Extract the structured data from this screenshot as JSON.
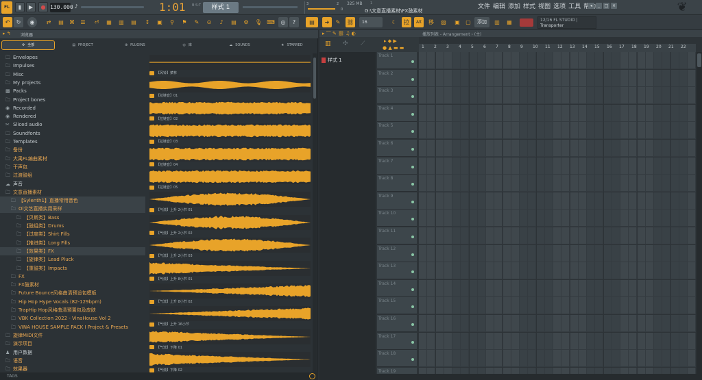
{
  "transport": {
    "tempo": "130.000",
    "time": "1:01",
    "time_sub": "00",
    "time_unit": "B:S:T",
    "pattern": "样式 1",
    "memory": "325 MB",
    "path": "G:\\文意直播素材\\FX鼓素材",
    "path_counter": "1",
    "cpu_value": "3",
    "poly_value": "2",
    "poly_sub": "0"
  },
  "menu": [
    "文件",
    "编辑",
    "添加",
    "样式",
    "视图",
    "选项",
    "工具",
    "帮助"
  ],
  "hint": {
    "line1": "12/16  FL STUDIO |",
    "line2": "Transporter"
  },
  "toolbar": {
    "snap": "16",
    "add_label": "添加",
    "mix_label": "Alt"
  },
  "browser": {
    "title": "浏览器",
    "tabs": [
      "全部",
      "PROJECT",
      "PLUGINS",
      "库",
      "SOUNDS",
      "STARRED"
    ],
    "tree": [
      {
        "label": "Envelopes",
        "orange": false,
        "indent": 0,
        "icon": "folder"
      },
      {
        "label": "Impulses",
        "orange": false,
        "indent": 0,
        "icon": "folder"
      },
      {
        "label": "Misc",
        "orange": false,
        "indent": 0,
        "icon": "folder"
      },
      {
        "label": "My projects",
        "orange": false,
        "indent": 0,
        "icon": "folder"
      },
      {
        "label": "Packs",
        "orange": false,
        "indent": 0,
        "icon": "packs"
      },
      {
        "label": "Project bones",
        "orange": false,
        "indent": 0,
        "icon": "folder"
      },
      {
        "label": "Recorded",
        "orange": false,
        "indent": 0,
        "icon": "record"
      },
      {
        "label": "Rendered",
        "orange": false,
        "indent": 0,
        "icon": "record"
      },
      {
        "label": "Sliced audio",
        "orange": false,
        "indent": 0,
        "icon": "slice"
      },
      {
        "label": "Soundfonts",
        "orange": false,
        "indent": 0,
        "icon": "folder"
      },
      {
        "label": "Templates",
        "orange": false,
        "indent": 0,
        "icon": "folder"
      },
      {
        "label": "备份",
        "orange": true,
        "indent": 0,
        "icon": "folder"
      },
      {
        "label": "大禹FL编曲素材",
        "orange": true,
        "indent": 0,
        "icon": "folder"
      },
      {
        "label": "干声包",
        "orange": true,
        "indent": 0,
        "icon": "folder"
      },
      {
        "label": "过渡鼓组",
        "orange": true,
        "indent": 0,
        "icon": "folder"
      },
      {
        "label": "声音",
        "orange": false,
        "indent": 0,
        "icon": "cloud"
      },
      {
        "label": "文意直播素材",
        "orange": true,
        "indent": 0,
        "icon": "folder"
      },
      {
        "label": "【Sylenth1】直播常用音色",
        "orange": true,
        "indent": 1,
        "icon": "folder"
      },
      {
        "label": "Ol文艺直播实用采样",
        "orange": true,
        "indent": 1,
        "icon": "folder"
      },
      {
        "label": "【贝斯类】Bass",
        "orange": true,
        "indent": 2,
        "icon": "folder"
      },
      {
        "label": "【鼓组类】Drums",
        "orange": true,
        "indent": 2,
        "icon": "folder"
      },
      {
        "label": "【过度类】Shirt Fills",
        "orange": true,
        "indent": 2,
        "icon": "folder"
      },
      {
        "label": "【推进类】Long Fills",
        "orange": true,
        "indent": 2,
        "icon": "folder"
      },
      {
        "label": "【效果类】FX",
        "orange": true,
        "indent": 2,
        "icon": "folder"
      },
      {
        "label": "【旋律类】Lead Pluck",
        "orange": true,
        "indent": 2,
        "icon": "folder"
      },
      {
        "label": "【重鼓类】Impacts",
        "orange": true,
        "indent": 2,
        "icon": "folder"
      },
      {
        "label": "FX",
        "orange": true,
        "indent": 1,
        "icon": "folder"
      },
      {
        "label": "FX鼓素材",
        "orange": true,
        "indent": 1,
        "icon": "folder"
      },
      {
        "label": "Future Bounce风格曲清预设包模板",
        "orange": true,
        "indent": 1,
        "icon": "folder"
      },
      {
        "label": "Hip Hop Hype Vocals (82-129bpm)",
        "orange": true,
        "indent": 1,
        "icon": "folder"
      },
      {
        "label": "TrapHip Hop风格曲清预置包及皮肤",
        "orange": true,
        "indent": 1,
        "icon": "folder"
      },
      {
        "label": "VBK Collection 2022 - VinaHouse Vol 2",
        "orange": true,
        "indent": 1,
        "icon": "folder"
      },
      {
        "label": "VINA HOUSE SAMPLE PACK I Project & Presets",
        "orange": true,
        "indent": 1,
        "icon": "folder"
      },
      {
        "label": "旋律MIDI文件",
        "orange": true,
        "indent": 0,
        "icon": "folder"
      },
      {
        "label": "演示项目",
        "orange": true,
        "indent": 0,
        "icon": "folder"
      },
      {
        "label": "用户数据",
        "orange": false,
        "indent": 0,
        "icon": "user"
      },
      {
        "label": "语音",
        "orange": true,
        "indent": 0,
        "icon": "folder"
      },
      {
        "label": "效果器",
        "orange": true,
        "indent": 0,
        "icon": "folder"
      }
    ],
    "highlighted_rows": [
      17,
      18,
      23
    ],
    "samples": [
      {
        "label": "【风铃】菜林",
        "shape": "flat"
      },
      {
        "label": "【拉链音】01",
        "shape": "burst"
      },
      {
        "label": "【拉链音】02",
        "shape": "dense"
      },
      {
        "label": "【拉链音】03",
        "shape": "dense"
      },
      {
        "label": "【拉链音】04",
        "shape": "dense"
      },
      {
        "label": "【拉链音】05",
        "shape": "dense"
      },
      {
        "label": "【气流】上升 2小节 01",
        "shape": "swell"
      },
      {
        "label": "【气流】上升 2小节 02",
        "shape": "swell"
      },
      {
        "label": "【气流】上升 2小节 03",
        "shape": "swell"
      },
      {
        "label": "【气流】上升 8小节 01",
        "shape": "fade"
      },
      {
        "label": "【气流】上升 8小节 02",
        "shape": "rise"
      },
      {
        "label": "【气流】上升 16小节",
        "shape": "rise"
      },
      {
        "label": "【气流】下降 01",
        "shape": "fade"
      },
      {
        "label": "【气流】下降 02",
        "shape": "fade"
      }
    ],
    "tags_label": "TAGS"
  },
  "playlist": {
    "title": "播放列表 - Arrangement › (主)",
    "pattern_name": "样式 1",
    "tracks": [
      "Track 1",
      "Track 2",
      "Track 3",
      "Track 4",
      "Track 5",
      "Track 6",
      "Track 7",
      "Track 8",
      "Track 9",
      "Track 10",
      "Track 11",
      "Track 12",
      "Track 13",
      "Track 14",
      "Track 15",
      "Track 16",
      "Track 17",
      "Track 18",
      "Track 19"
    ],
    "bars": [
      "1",
      "2",
      "3",
      "4",
      "5",
      "6",
      "7",
      "8",
      "9",
      "10",
      "11",
      "12",
      "13",
      "14",
      "15",
      "16",
      "17",
      "18",
      "19",
      "20",
      "21",
      "22"
    ]
  },
  "colors": {
    "accent": "#e8a329",
    "waveform": "#e8a329",
    "background": "#2a2f33",
    "record": "#d24b4b"
  }
}
